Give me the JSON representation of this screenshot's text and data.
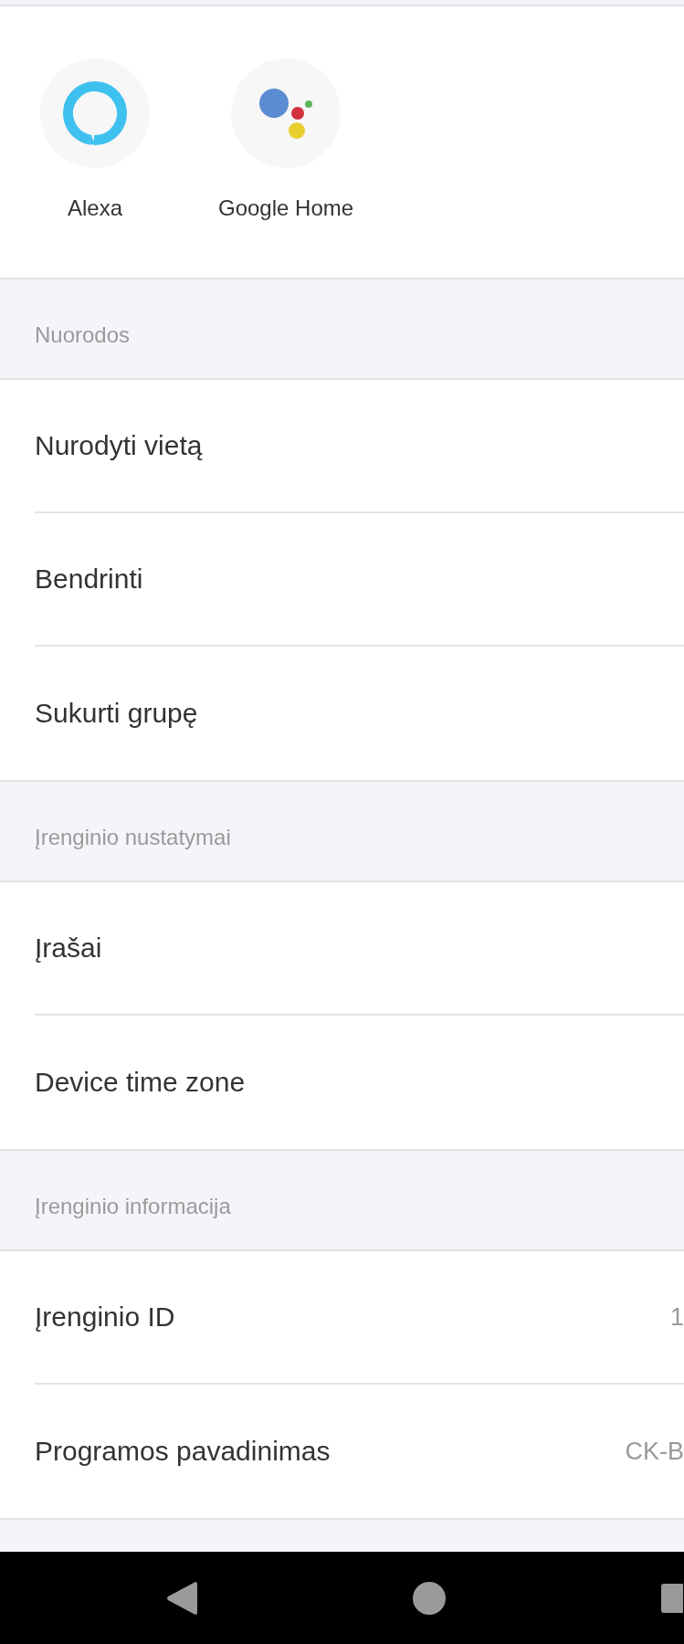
{
  "integrations": [
    {
      "kind": "alexa",
      "label": "Alexa"
    },
    {
      "kind": "google",
      "label": "Google Home"
    }
  ],
  "sections": [
    {
      "header": "Nuorodos",
      "rows": [
        {
          "label": "Nurodyti vietą"
        },
        {
          "label": "Bendrinti"
        },
        {
          "label": "Sukurti grupę"
        }
      ]
    },
    {
      "header": "Įrenginio nustatymai",
      "rows": [
        {
          "label": "Įrašai"
        },
        {
          "label": "Device time zone"
        }
      ]
    },
    {
      "header": "Įrenginio informacija",
      "rows": [
        {
          "label": "Įrenginio ID",
          "value": "1"
        },
        {
          "label": "Programos pavadinimas",
          "value": "CK-B"
        }
      ]
    }
  ]
}
